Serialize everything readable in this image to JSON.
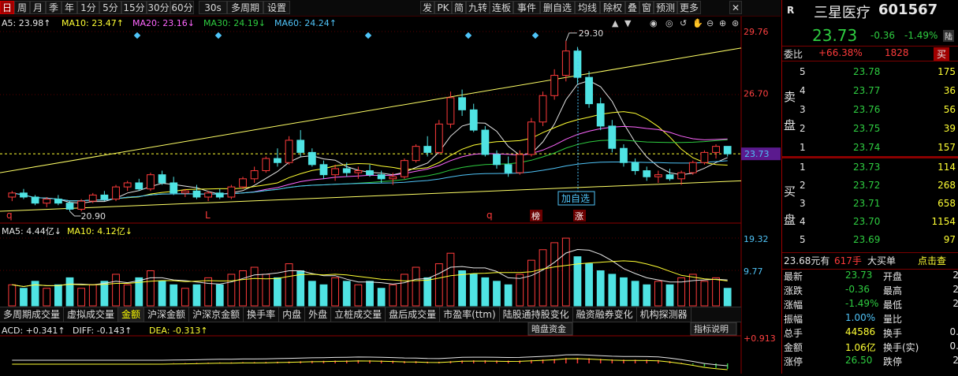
{
  "toolbar": {
    "periods": [
      "日",
      "周",
      "月",
      "季",
      "年",
      "1分",
      "5分",
      "15分",
      "30分",
      "60分",
      "30s",
      "多周期",
      "设置"
    ],
    "active_period": "日",
    "right_buttons": [
      "发",
      "PK",
      "简",
      "九转",
      "连板",
      "事件",
      "删自选",
      "均线",
      "除权",
      "叠",
      "窗",
      "预测",
      "更多"
    ]
  },
  "stock": {
    "market_tag": "R",
    "name": "三星医疗",
    "code": "601567",
    "price": "23.73",
    "change": "-0.36",
    "change_pct": "-1.49%",
    "exchange_tag": "陆"
  },
  "order_book": {
    "weibi_label": "委比",
    "weibi_value": "+66.38%",
    "weibi_count": "1828",
    "weibi_tag": "买",
    "sell_label": "卖盘",
    "buy_label": "买盘",
    "sell": [
      {
        "level": "5",
        "price": "23.78",
        "vol": "175"
      },
      {
        "level": "4",
        "price": "23.77",
        "vol": "36"
      },
      {
        "level": "3",
        "price": "23.76",
        "vol": "56"
      },
      {
        "level": "2",
        "price": "23.75",
        "vol": "39"
      },
      {
        "level": "1",
        "price": "23.74",
        "vol": "157"
      }
    ],
    "buy": [
      {
        "level": "1",
        "price": "23.73",
        "vol": "114"
      },
      {
        "level": "2",
        "price": "23.72",
        "vol": "268"
      },
      {
        "level": "3",
        "price": "23.71",
        "vol": "658"
      },
      {
        "level": "4",
        "price": "23.70",
        "vol": "1154"
      },
      {
        "level": "5",
        "price": "23.69",
        "vol": "97"
      }
    ]
  },
  "trade_summary": {
    "avg_text": "23.68元有",
    "hands": "617手",
    "big": "大买单",
    "click": "点击查"
  },
  "quote_table": [
    {
      "l": "最新",
      "v": "23.73",
      "l2": "开盘",
      "v2": "2"
    },
    {
      "l": "涨跌",
      "v": "-0.36",
      "l2": "最高",
      "v2": "2"
    },
    {
      "l": "涨幅",
      "v": "-1.49%",
      "l2": "最低",
      "v2": "2"
    },
    {
      "l": "振幅",
      "v": "1.00%",
      "l2": "量比",
      "v2": ""
    },
    {
      "l": "总手",
      "v": "44586",
      "l2": "换手",
      "v2": "0."
    },
    {
      "l": "金额",
      "v": "1.06亿",
      "l2": "换手(实)",
      "v2": "0."
    },
    {
      "l": "涨停",
      "v": "26.50",
      "l2": "跌停",
      "v2": "2"
    }
  ],
  "legends": {
    "ma": [
      {
        "text": "A5: 23.98↑",
        "color": "#e6e6e6"
      },
      {
        "text": "MA10: 23.47↑",
        "color": "#ffff33"
      },
      {
        "text": "MA20: 23.16↓",
        "color": "#ff66ff"
      },
      {
        "text": "MA30: 24.19↓",
        "color": "#2ecc40"
      },
      {
        "text": "MA60: 24.24↑",
        "color": "#4fc3f7"
      }
    ],
    "vol": [
      {
        "text": "MA5: 4.44亿↓",
        "color": "#e6e6e6"
      },
      {
        "text": "MA10: 4.12亿↓",
        "color": "#ffff33"
      }
    ],
    "macd": [
      {
        "text": "ACD: +0.341↑",
        "color": "#e6e6e6"
      },
      {
        "text": "DIFF: -0.143↑",
        "color": "#e6e6e6"
      },
      {
        "text": "DEA: -0.313↑",
        "color": "#ffff33"
      }
    ]
  },
  "axes": {
    "price_top": "29.76",
    "price_mid": "26.70",
    "price_current": "23.73",
    "vol_top": "19.32",
    "vol_mid": "9.77",
    "macd_top": "+0.913"
  },
  "annotations": {
    "high": "29.30",
    "low": "20.90",
    "add_watch": "加自选",
    "marker_q1": "q",
    "marker_L": "L",
    "marker_q2": "q",
    "badge_bang": "榜",
    "badge_zhang": "涨"
  },
  "indicator_tabs": {
    "items": [
      "多周期成交量",
      "虚拟成交量",
      "金额",
      "沪深金额",
      "沪深京金额",
      "换手率",
      "内盘",
      "外盘",
      "立桩成交量",
      "盘后成交量",
      "市盈率(ttm)",
      "陆股通持股变化",
      "融资融券变化",
      "机构探测器"
    ],
    "active": "金额",
    "dark_pool": "暗盘资金",
    "indicator_help": "指标说明"
  },
  "chart_data": {
    "type": "candlestick",
    "candles": [
      [
        21.6,
        21.9,
        21.4,
        21.8
      ],
      [
        21.8,
        22.0,
        21.5,
        21.6
      ],
      [
        21.6,
        21.7,
        21.2,
        21.3
      ],
      [
        21.3,
        21.6,
        21.1,
        21.5
      ],
      [
        21.5,
        21.7,
        21.2,
        21.3
      ],
      [
        21.3,
        21.4,
        20.9,
        21.0
      ],
      [
        21.0,
        21.5,
        20.9,
        21.4
      ],
      [
        21.4,
        21.8,
        21.3,
        21.7
      ],
      [
        21.7,
        21.9,
        21.4,
        21.5
      ],
      [
        21.5,
        22.2,
        21.4,
        22.1
      ],
      [
        22.1,
        22.4,
        21.9,
        22.3
      ],
      [
        22.3,
        22.5,
        21.9,
        22.0
      ],
      [
        22.0,
        22.8,
        21.9,
        22.7
      ],
      [
        22.7,
        22.9,
        22.2,
        22.3
      ],
      [
        22.3,
        22.6,
        21.7,
        21.8
      ],
      [
        21.8,
        22.0,
        21.6,
        21.9
      ],
      [
        21.9,
        22.2,
        21.5,
        21.6
      ],
      [
        21.6,
        21.9,
        21.4,
        21.8
      ],
      [
        21.8,
        22.0,
        21.5,
        21.6
      ],
      [
        21.6,
        22.2,
        21.5,
        22.1
      ],
      [
        22.1,
        22.6,
        22.0,
        22.5
      ],
      [
        22.5,
        23.1,
        22.3,
        22.9
      ],
      [
        22.9,
        23.6,
        22.8,
        23.5
      ],
      [
        23.5,
        24.0,
        23.1,
        23.3
      ],
      [
        23.3,
        24.6,
        23.2,
        24.4
      ],
      [
        24.4,
        24.9,
        23.6,
        23.8
      ],
      [
        23.8,
        24.0,
        23.1,
        23.2
      ],
      [
        23.2,
        23.4,
        22.5,
        22.7
      ],
      [
        22.7,
        23.2,
        22.4,
        23.0
      ],
      [
        23.0,
        23.3,
        22.6,
        22.8
      ],
      [
        22.8,
        23.1,
        22.5,
        22.9
      ],
      [
        22.9,
        23.2,
        22.6,
        22.7
      ],
      [
        22.7,
        22.9,
        22.3,
        22.5
      ],
      [
        22.5,
        22.8,
        22.2,
        22.6
      ],
      [
        22.6,
        23.5,
        22.5,
        23.4
      ],
      [
        23.4,
        24.2,
        23.3,
        24.1
      ],
      [
        24.1,
        24.6,
        23.6,
        23.8
      ],
      [
        23.8,
        25.4,
        23.7,
        25.2
      ],
      [
        25.2,
        26.8,
        25.0,
        26.5
      ],
      [
        26.5,
        26.9,
        25.6,
        25.9
      ],
      [
        25.9,
        26.2,
        24.8,
        24.9
      ],
      [
        24.9,
        25.1,
        23.6,
        23.7
      ],
      [
        23.7,
        23.9,
        23.0,
        23.2
      ],
      [
        23.2,
        23.6,
        22.6,
        22.8
      ],
      [
        22.8,
        23.9,
        22.7,
        23.7
      ],
      [
        23.7,
        25.5,
        23.6,
        25.3
      ],
      [
        25.3,
        26.8,
        25.1,
        26.6
      ],
      [
        26.6,
        27.9,
        26.4,
        27.6
      ],
      [
        27.6,
        29.3,
        27.3,
        28.8
      ],
      [
        28.8,
        29.0,
        27.2,
        27.5
      ],
      [
        27.5,
        27.8,
        26.0,
        26.2
      ],
      [
        26.2,
        26.5,
        24.9,
        25.1
      ],
      [
        25.1,
        25.4,
        23.8,
        24.0
      ],
      [
        24.0,
        24.2,
        23.1,
        23.3
      ],
      [
        23.3,
        23.5,
        22.7,
        22.9
      ],
      [
        22.9,
        23.1,
        22.4,
        22.6
      ],
      [
        22.6,
        22.9,
        22.3,
        22.7
      ],
      [
        22.7,
        23.0,
        22.4,
        22.5
      ],
      [
        22.5,
        22.9,
        22.2,
        22.8
      ],
      [
        22.8,
        23.4,
        22.7,
        23.3
      ],
      [
        23.3,
        23.9,
        23.2,
        23.8
      ],
      [
        23.8,
        24.2,
        23.5,
        24.1
      ],
      [
        24.1,
        24.1,
        23.6,
        23.73
      ]
    ],
    "volumes": [
      6,
      5,
      7,
      5,
      6,
      8,
      5,
      6,
      7,
      9,
      6,
      8,
      10,
      7,
      6,
      5,
      6,
      8,
      6,
      9,
      10,
      11,
      9,
      8,
      12,
      10,
      7,
      6,
      8,
      7,
      6,
      7,
      5,
      6,
      9,
      11,
      8,
      12,
      15,
      10,
      9,
      8,
      7,
      6,
      9,
      13,
      16,
      18,
      19.3,
      14,
      12,
      10,
      9,
      8,
      7,
      6,
      7,
      6,
      8,
      9,
      7,
      8,
      5
    ]
  }
}
